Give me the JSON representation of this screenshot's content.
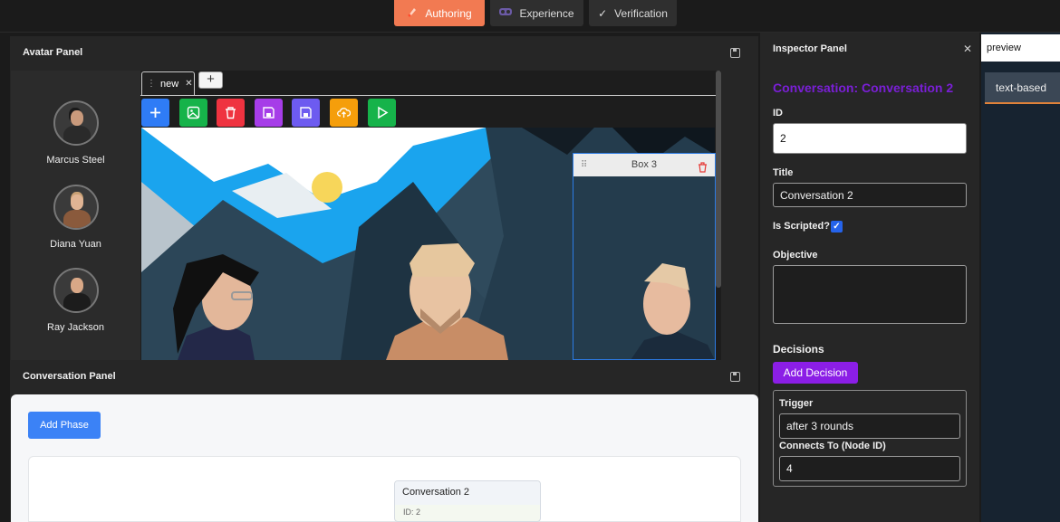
{
  "top_tabs": [
    {
      "label": "Authoring",
      "icon": "brush-icon",
      "active": true
    },
    {
      "label": "Experience",
      "icon": "vr-goggles-icon",
      "active": false
    },
    {
      "label": "Verification",
      "icon": "check-icon",
      "active": false
    }
  ],
  "avatar_panel": {
    "title": "Avatar Panel",
    "avatars": [
      {
        "name": "Marcus Steel"
      },
      {
        "name": "Diana Yuan"
      },
      {
        "name": "Ray Jackson"
      }
    ]
  },
  "scene_editor": {
    "tab_label": "new",
    "add_tab_label": "+",
    "toolbar": [
      {
        "name": "add-button",
        "icon": "plus-icon",
        "color": "#2f7cf6"
      },
      {
        "name": "add-image-button",
        "icon": "image-icon",
        "color": "#16b34a"
      },
      {
        "name": "delete-button",
        "icon": "trash-icon",
        "color": "#ef3340"
      },
      {
        "name": "save-button",
        "icon": "save-icon",
        "color": "#a63de8"
      },
      {
        "name": "save-as-button",
        "icon": "save-icon",
        "color": "#6d5bf0"
      },
      {
        "name": "upload-button",
        "icon": "cloud-upload-icon",
        "color": "#f59e0b"
      },
      {
        "name": "play-button",
        "icon": "play-icon",
        "color": "#16b34a"
      }
    ],
    "box_title": "Box 3"
  },
  "conversation_panel": {
    "title": "Conversation Panel",
    "add_phase_label": "Add Phase",
    "node": {
      "title": "Conversation 2",
      "id_text": "ID: 2"
    }
  },
  "inspector": {
    "title": "Inspector Panel",
    "heading": "Conversation: Conversation 2",
    "id_label": "ID",
    "id_value": "2",
    "title_label": "Title",
    "title_value": "Conversation 2",
    "scripted_label": "Is Scripted?",
    "scripted_checked": true,
    "objective_label": "Objective",
    "objective_value": "",
    "decisions_label": "Decisions",
    "add_decision_label": "Add Decision",
    "decision": {
      "trigger_label": "Trigger",
      "trigger_value": "after 3 rounds",
      "connects_label": "Connects To (Node ID)",
      "connects_value": "4"
    }
  },
  "preview": {
    "title": "preview",
    "tab_label": "text-based"
  },
  "colors": {
    "accent_orange": "#f27a52",
    "purple": "#8b1ee6",
    "heading_purple": "#7a1fd6",
    "blue": "#3b82f6"
  }
}
